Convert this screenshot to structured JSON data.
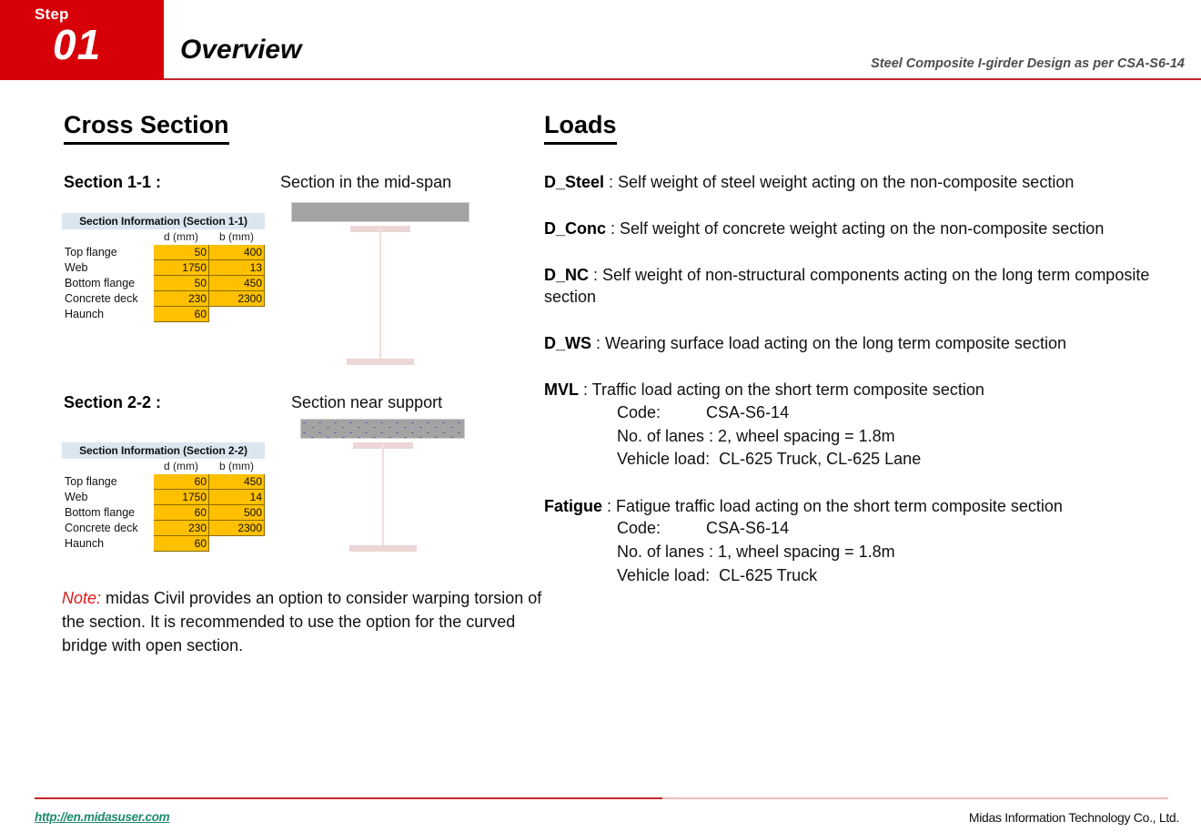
{
  "header": {
    "step_word": "Step",
    "step_number": "01",
    "title": "Overview",
    "subtitle": "Steel Composite I-girder Design as per CSA-S6-14"
  },
  "left_column": {
    "heading": "Cross Section",
    "section_1": {
      "label": "Section 1-1 :",
      "caption": "Section in the mid-span",
      "table": {
        "title": "Section Information (Section 1-1)",
        "columns": [
          "",
          "d (mm)",
          "b (mm)"
        ],
        "rows": [
          {
            "name": "Top flange",
            "d": "50",
            "b": "400"
          },
          {
            "name": "Web",
            "d": "1750",
            "b": "13"
          },
          {
            "name": "Bottom flange",
            "d": "50",
            "b": "450"
          },
          {
            "name": "Concrete deck",
            "d": "230",
            "b": "2300"
          },
          {
            "name": "Haunch",
            "d": "60",
            "b": ""
          }
        ]
      }
    },
    "section_2": {
      "label": "Section 2-2 :",
      "caption": "Section near support",
      "table": {
        "title": "Section Information (Section 2-2)",
        "columns": [
          "",
          "d (mm)",
          "b (mm)"
        ],
        "rows": [
          {
            "name": "Top flange",
            "d": "60",
            "b": "450"
          },
          {
            "name": "Web",
            "d": "1750",
            "b": "14"
          },
          {
            "name": "Bottom flange",
            "d": "60",
            "b": "500"
          },
          {
            "name": "Concrete deck",
            "d": "230",
            "b": "2300"
          },
          {
            "name": "Haunch",
            "d": "60",
            "b": ""
          }
        ]
      }
    },
    "note": {
      "tag": "Note:",
      "text": " midas Civil provides an option to consider warping torsion of the section. It is recommended to use the option for the curved bridge with open section."
    }
  },
  "right_column": {
    "heading": "Loads",
    "items": [
      {
        "key": "D_Steel",
        "text": " : Self weight of steel weight acting on the non-composite section",
        "sub": []
      },
      {
        "key": "D_Conc",
        "text": " : Self weight of concrete weight acting on the non-composite section",
        "sub": []
      },
      {
        "key": "D_NC",
        "text": " :  Self weight of non-structural components acting on the long term composite section",
        "sub": []
      },
      {
        "key": "D_WS",
        "text": " : Wearing surface load acting on the long term composite section",
        "sub": []
      },
      {
        "key": "MVL",
        "text": " : Traffic load acting on the short term composite section",
        "sub": [
          "Code:          CSA-S6-14",
          "No. of lanes : 2, wheel spacing = 1.8m",
          "Vehicle load:  CL-625 Truck, CL-625 Lane"
        ]
      },
      {
        "key": "Fatigue",
        "text": " : Fatigue traffic load acting on the short term composite section",
        "sub": [
          "Code:          CSA-S6-14",
          "No. of lanes : 1, wheel spacing = 1.8m",
          "Vehicle load:  CL-625 Truck"
        ]
      }
    ]
  },
  "footer": {
    "link": "http://en.midasuser.com",
    "company": "Midas Information Technology Co., Ltd."
  },
  "colors": {
    "brand_red": "#d70009",
    "rule_red": "#c0282c",
    "rule_pink": "#f0b9bd",
    "table_header_blue": "#dce6f1",
    "table_value_orange": "#ffc000",
    "deck_gray": "#a3a3a3",
    "girder_pink": "#ecd6d6",
    "note_red": "#e01818",
    "footer_link_teal": "#1f8a70"
  }
}
